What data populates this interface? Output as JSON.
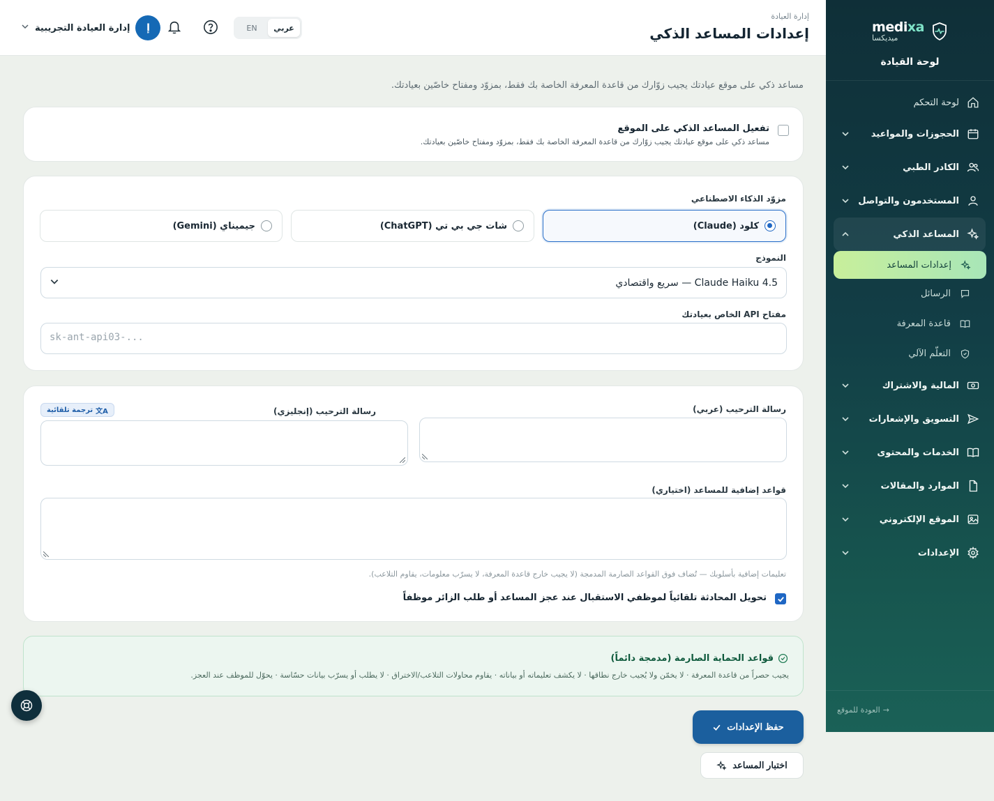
{
  "sidebar": {
    "brand_en_main": "medi",
    "brand_en_accent": "xa",
    "brand_ar": "ميديكسا",
    "subtitle": "لوحة القيادة",
    "items": [
      {
        "label": "لوحة التحكم",
        "icon": "home-icon"
      },
      {
        "label": "الحجوزات والمواعيد",
        "icon": "calendar-icon"
      },
      {
        "label": "الكادر الطبي",
        "icon": "users-icon"
      },
      {
        "label": "المستخدمون والتواصل",
        "icon": "user-icon"
      },
      {
        "label": "المساعد الذكي",
        "icon": "sparkles-icon"
      },
      {
        "label": "المالية والاشتراك",
        "icon": "money-icon"
      },
      {
        "label": "التسويق والإشعارات",
        "icon": "send-icon"
      },
      {
        "label": "الخدمات والمحتوى",
        "icon": "book-icon"
      },
      {
        "label": "الموارد والمقالات",
        "icon": "file-icon"
      },
      {
        "label": "الموقع الإلكتروني",
        "icon": "image-icon"
      },
      {
        "label": "الإعدادات",
        "icon": "gear-icon"
      }
    ],
    "sub_items": [
      {
        "label": "إعدادات المساعد",
        "icon": "sparkles-icon"
      },
      {
        "label": "الرسائل",
        "icon": "chat-icon"
      },
      {
        "label": "قاعدة المعرفة",
        "icon": "book-open-icon"
      },
      {
        "label": "التعلّم الآلي",
        "icon": "shield-icon"
      }
    ],
    "back_link": "العودة للموقع"
  },
  "header": {
    "breadcrumb": "إدارة العيادة",
    "title": "إعدادات المساعد الذكي",
    "lang_ar": "عربي",
    "lang_en": "EN",
    "user_initial": "إ",
    "user_name": "إدارة العيادة التجريبية"
  },
  "main": {
    "intro": "مساعد ذكي على موقع عيادتك يجيب زوّارك من قاعدة المعرفة الخاصة بك فقط، بمزوّد ومفتاح خاصّين بعيادتك.",
    "enable": {
      "title": "تفعيل المساعد الذكي على الموقع",
      "desc": "مساعد ذكي على موقع عيادتك يجيب زوّارك من قاعدة المعرفة الخاصة بك فقط، بمزوّد ومفتاح خاصّين بعيادتك.",
      "checked": false
    },
    "provider": {
      "label": "مزوّد الذكاء الاصطناعي",
      "options": [
        "كلود (Claude)",
        "شات جي بي تي (ChatGPT)",
        "جيميناي (Gemini)"
      ],
      "selected": "كلود (Claude)"
    },
    "model": {
      "label": "النموذج",
      "value": "Claude Haiku 4.5 — سريع واقتصادي"
    },
    "api_key": {
      "label": "مفتاح API الخاص بعيادتك",
      "placeholder": "sk-ant-api03-..."
    },
    "welcome_ar": {
      "label": "رسالة الترحيب (عربي)",
      "value": ""
    },
    "welcome_en": {
      "label": "رسالة الترحيب (إنجليزي)",
      "value": ""
    },
    "auto_translate": "ترجمة تلقائية",
    "rules": {
      "label": "قواعد إضافية للمساعد (اختياري)",
      "value": "",
      "hint": "تعليمات إضافية بأسلوبك — تُضاف فوق القواعد الصارمة المدمجة (لا يجيب خارج قاعدة المعرفة، لا يسرّب معلومات، يقاوم التلاعب)."
    },
    "handoff": {
      "label": "تحويل المحادثة تلقائياً لموظفي الاستقبال عند عجز المساعد أو طلب الزائر موظفاً",
      "checked": true
    },
    "guard": {
      "title": "قواعد الحماية الصارمة (مدمجة دائماً)",
      "text": "يجيب حصراً من قاعدة المعرفة · لا يخمّن ولا يُجيب خارج نطاقها · لا يكشف تعليماته أو بياناته · يقاوم محاولات التلاعب/الاختراق · لا يطلب أو يسرّب بيانات حسّاسة · يحوّل للموظف عند العجز."
    },
    "save_label": "حفظ الإعدادات",
    "test_label": "اختبار المساعد"
  },
  "colors": {
    "primary": "#1b5f9e",
    "sidebar_top": "#0f2f38",
    "active_sub": "#c8ef9b",
    "guard_bg": "#ecf6f0"
  }
}
